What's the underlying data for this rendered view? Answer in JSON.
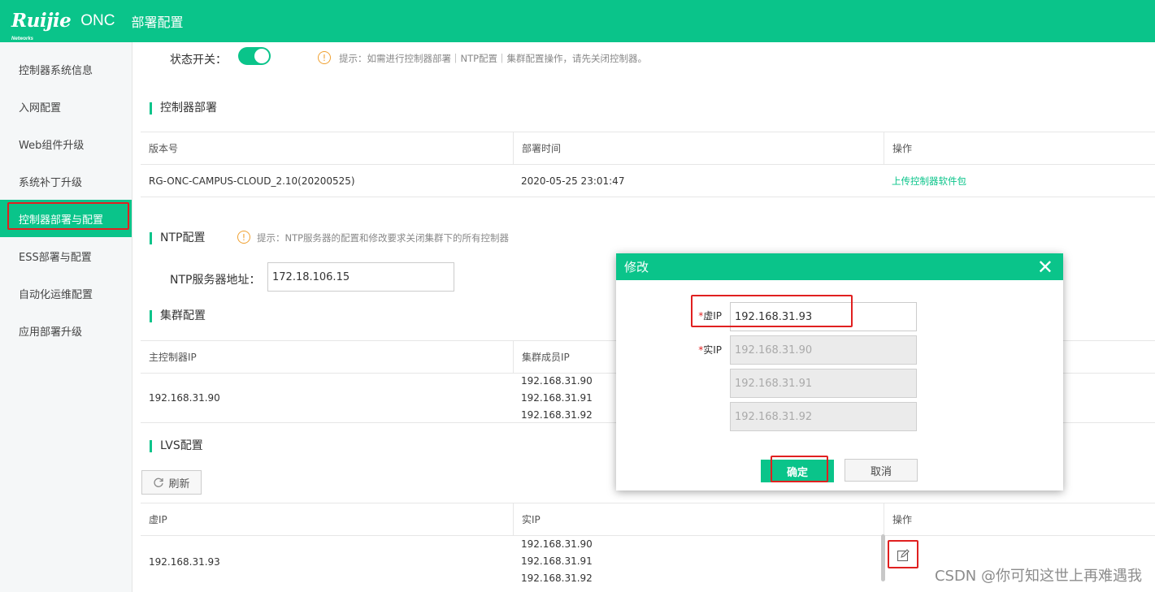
{
  "header": {
    "logo": "Ruijie",
    "logo_sub": "Networks",
    "product": "ONC",
    "title": "部署配置"
  },
  "sidebar": {
    "items": [
      {
        "label": "控制器系统信息"
      },
      {
        "label": "入网配置"
      },
      {
        "label": "Web组件升级"
      },
      {
        "label": "系统补丁升级"
      },
      {
        "label": "控制器部署与配置"
      },
      {
        "label": "ESS部署与配置"
      },
      {
        "label": "自动化运维配置"
      },
      {
        "label": "应用部署升级"
      }
    ]
  },
  "status": {
    "label": "状态开关：",
    "on": true,
    "hint": "提示：如需进行控制器部署｜NTP配置｜集群配置操作，请先关闭控制器。"
  },
  "deploy": {
    "title": "控制器部署",
    "headers": [
      "版本号",
      "部署时间",
      "操作"
    ],
    "row": {
      "version": "RG-ONC-CAMPUS-CLOUD_2.10(20200525)",
      "time": "2020-05-25 23:01:47",
      "action": "上传控制器软件包"
    }
  },
  "ntp": {
    "title": "NTP配置",
    "hint": "提示：NTP服务器的配置和修改要求关闭集群下的所有控制器",
    "label": "NTP服务器地址：",
    "value": "172.18.106.15"
  },
  "cluster": {
    "title": "集群配置",
    "headers": [
      "主控制器IP",
      "集群成员IP"
    ],
    "master": "192.168.31.90",
    "members": [
      "192.168.31.90",
      "192.168.31.91",
      "192.168.31.92"
    ]
  },
  "lvs": {
    "title": "LVS配置",
    "refresh": "刷新",
    "headers": [
      "虚IP",
      "实IP",
      "操作"
    ],
    "vip": "192.168.31.93",
    "real": [
      "192.168.31.90",
      "192.168.31.91",
      "192.168.31.92"
    ]
  },
  "modal": {
    "title": "修改",
    "vip_label": "虚IP",
    "vip_value": "192.168.31.93",
    "real_label": "实IP",
    "real_values": [
      "192.168.31.90",
      "192.168.31.91",
      "192.168.31.92"
    ],
    "ok": "确定",
    "cancel": "取消"
  },
  "watermark": "CSDN @你可知这世上再难遇我",
  "colors": {
    "brand": "#0ac48a",
    "highlight": "#e02020"
  }
}
